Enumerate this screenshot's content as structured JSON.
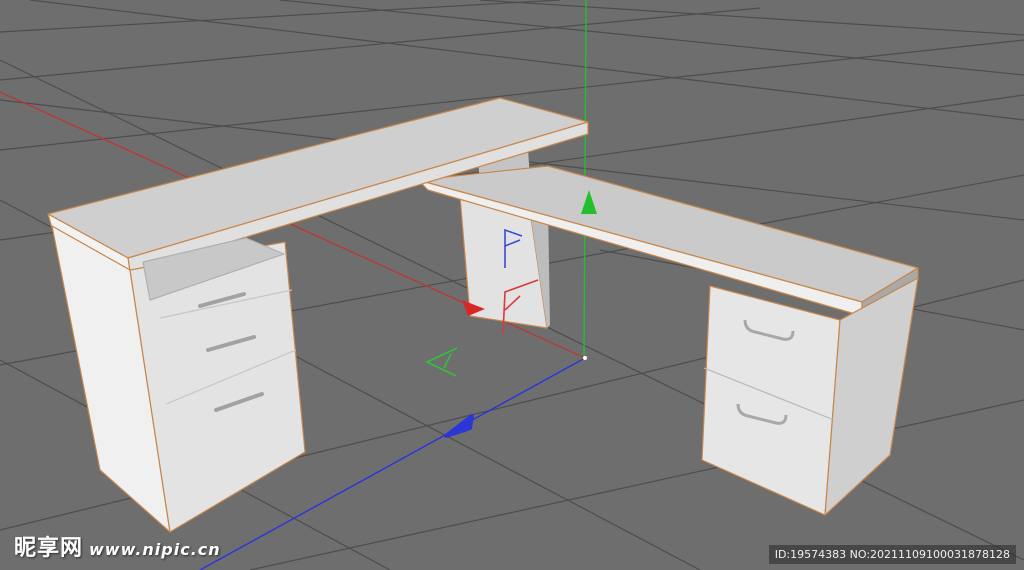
{
  "viewport": {
    "background": "#6e6e6e",
    "grid_color": "#4a4a4a",
    "object": "l-shaped-desk",
    "axes": {
      "x_color": "#d62828",
      "y_color": "#22c02a",
      "z_color": "#2a36d6"
    },
    "selection_outline_color": "#c8864a",
    "desk_color": "#d8d8d8"
  },
  "watermark": {
    "logo": "昵享网",
    "url": "www.nipic.cn",
    "id_text": "ID:19574383 NO:20211109100031878128"
  }
}
